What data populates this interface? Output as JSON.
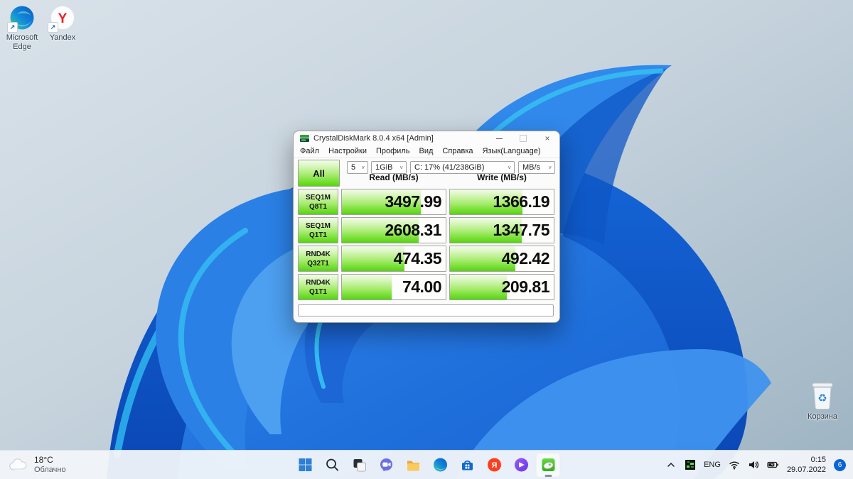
{
  "desktop_icons": {
    "edge": "Microsoft Edge",
    "yandex": "Yandex",
    "recycle_bin": "Корзина"
  },
  "window": {
    "title": "CrystalDiskMark 8.0.4 x64 [Admin]",
    "menu": {
      "file": "Файл",
      "settings": "Настройки",
      "profile": "Профиль",
      "view": "Вид",
      "help": "Справка",
      "language": "Язык(Language)"
    },
    "controls": {
      "all": "All",
      "count": "5",
      "size": "1GiB",
      "drive": "C: 17% (41/238GiB)",
      "unit": "MB/s",
      "chevron": "˅"
    },
    "headers": {
      "read": "Read (MB/s)",
      "write": "Write (MB/s)"
    },
    "rows": [
      {
        "name": "SEQ1M",
        "queue": "Q8T1",
        "read": "3497.99",
        "write": "1366.19",
        "read_fill": 76,
        "write_fill": 70
      },
      {
        "name": "SEQ1M",
        "queue": "Q1T1",
        "read": "2608.31",
        "write": "1347.75",
        "read_fill": 74,
        "write_fill": 69
      },
      {
        "name": "RND4K",
        "queue": "Q32T1",
        "read": "474.35",
        "write": "492.42",
        "read_fill": 60,
        "write_fill": 63
      },
      {
        "name": "RND4K",
        "queue": "Q1T1",
        "read": "74.00",
        "write": "209.81",
        "read_fill": 48,
        "write_fill": 55
      }
    ],
    "window_buttons": {
      "minimize": "–",
      "maximize": "□",
      "close": "×"
    }
  },
  "taskbar": {
    "weather": {
      "temp": "18°C",
      "condition": "Облачно"
    },
    "icons": [
      "start",
      "search",
      "task-view",
      "chat",
      "file-explorer",
      "edge",
      "store",
      "yandex-browser",
      "alice",
      "crystaldiskmark"
    ],
    "tray": {
      "language": "ENG",
      "time": "0:15",
      "date": "29.07.2022",
      "notification_count": "6"
    }
  },
  "colors": {
    "benchmark_green": "#58d313",
    "accent_blue": "#0b63d8",
    "petal_blue": "#2076e4",
    "petal_cyan": "#35c3f4",
    "taskbar_bg": "#f2f6fa"
  }
}
